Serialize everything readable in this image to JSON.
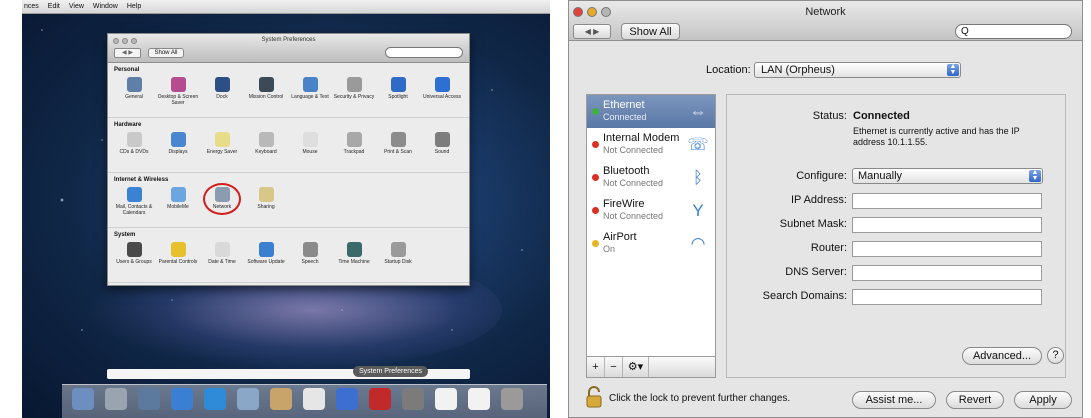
{
  "left": {
    "menubar": [
      "nces",
      "Edit",
      "View",
      "Window",
      "Help"
    ],
    "window_title": "System Preferences",
    "show_all_label": "Show All",
    "sections": [
      {
        "title": "Personal",
        "items": [
          {
            "label": "General",
            "icon": "general-icon",
            "color": "#5f7ea8"
          },
          {
            "label": "Desktop & Screen Saver",
            "icon": "desktop-icon",
            "color": "#b44c8f"
          },
          {
            "label": "Dock",
            "icon": "dock-icon",
            "color": "#2e4e86"
          },
          {
            "label": "Mission Control",
            "icon": "mission-control-icon",
            "color": "#3c4a58"
          },
          {
            "label": "Language & Text",
            "icon": "language-icon",
            "color": "#4a82c8"
          },
          {
            "label": "Security & Privacy",
            "icon": "security-icon",
            "color": "#9a9a9a"
          },
          {
            "label": "Spotlight",
            "icon": "spotlight-icon",
            "color": "#2f6bc6"
          },
          {
            "label": "Universal Access",
            "icon": "universal-access-icon",
            "color": "#2d6fd3"
          }
        ]
      },
      {
        "title": "Hardware",
        "items": [
          {
            "label": "CDs & DVDs",
            "icon": "cd-icon",
            "color": "#c9c9c9"
          },
          {
            "label": "Displays",
            "icon": "displays-icon",
            "color": "#4a86d0"
          },
          {
            "label": "Energy Saver",
            "icon": "energy-icon",
            "color": "#e7dc8a"
          },
          {
            "label": "Keyboard",
            "icon": "keyboard-icon",
            "color": "#b9b9b9"
          },
          {
            "label": "Mouse",
            "icon": "mouse-icon",
            "color": "#dedede"
          },
          {
            "label": "Trackpad",
            "icon": "trackpad-icon",
            "color": "#a8a8a8"
          },
          {
            "label": "Print & Scan",
            "icon": "printer-icon",
            "color": "#8c8c8c"
          },
          {
            "label": "Sound",
            "icon": "sound-icon",
            "color": "#7d7d7d"
          }
        ]
      },
      {
        "title": "Internet & Wireless",
        "items": [
          {
            "label": "Mail, Contacts & Calendars",
            "icon": "mail-icon",
            "color": "#3a82d2"
          },
          {
            "label": "MobileMe",
            "icon": "mobileme-icon",
            "color": "#6ba6e0"
          },
          {
            "label": "Network",
            "icon": "network-icon",
            "color": "#8b9bb0"
          },
          {
            "label": "Sharing",
            "icon": "sharing-icon",
            "color": "#d7c88a"
          }
        ]
      },
      {
        "title": "System",
        "items": [
          {
            "label": "Users & Groups",
            "icon": "users-icon",
            "color": "#4a4a4a"
          },
          {
            "label": "Parental Controls",
            "icon": "parental-controls-icon",
            "color": "#e7c12d"
          },
          {
            "label": "Date & Time",
            "icon": "date-time-icon",
            "color": "#d9d9d9"
          },
          {
            "label": "Software Update",
            "icon": "software-update-icon",
            "color": "#3a7fd0"
          },
          {
            "label": "Speech",
            "icon": "speech-icon",
            "color": "#8a8a8a"
          },
          {
            "label": "Time Machine",
            "icon": "time-machine-icon",
            "color": "#3a6a6a"
          },
          {
            "label": "Startup Disk",
            "icon": "startup-disk-icon",
            "color": "#9a9a9a"
          }
        ]
      }
    ],
    "highlighted_item": "Network",
    "highlight_color": "#d21d1d",
    "dock_tooltip": "System Preferences",
    "dock_icons": [
      "finder-icon",
      "launchpad-icon",
      "photo-browser-icon",
      "app-store-icon",
      "safari-icon",
      "mail-icon",
      "contacts-icon",
      "calendar-icon",
      "itunes-icon",
      "photo-booth-icon",
      "system-preferences-icon",
      "document-icon",
      "document-icon",
      "trash-icon"
    ]
  },
  "right": {
    "window_title": "Network",
    "nav_label": "◀ ▶",
    "show_all_label": "Show All",
    "search_glyph": "Q",
    "location_label": "Location:",
    "location_value": "LAN (Orpheus)",
    "services": [
      {
        "name": "Ethernet",
        "status": "Connected",
        "dot": "#3cb043",
        "icon": "ethernet-icon",
        "glyph": "⇔",
        "selected": true
      },
      {
        "name": "Internal Modem",
        "status": "Not Connected",
        "dot": "#d93025",
        "icon": "modem-icon",
        "glyph": "☏",
        "selected": false
      },
      {
        "name": "Bluetooth",
        "status": "Not Connected",
        "dot": "#d93025",
        "icon": "bluetooth-icon",
        "glyph": "ᛒ",
        "selected": false
      },
      {
        "name": "FireWire",
        "status": "Not Connected",
        "dot": "#d93025",
        "icon": "firewire-icon",
        "glyph": "Y",
        "selected": false
      },
      {
        "name": "AirPort",
        "status": "On",
        "dot": "#e6b422",
        "icon": "airport-icon",
        "glyph": "◠",
        "selected": false
      }
    ],
    "list_buttons": [
      "+",
      "−",
      "⚙▾"
    ],
    "status_label": "Status:",
    "status_value": "Connected",
    "status_detail": "Ethernet is currently active and has the IP address 10.1.1.55.",
    "configure_label": "Configure:",
    "configure_value": "Manually",
    "fields": [
      {
        "label": "IP Address:",
        "value": ""
      },
      {
        "label": "Subnet Mask:",
        "value": ""
      },
      {
        "label": "Router:",
        "value": ""
      },
      {
        "label": "DNS Server:",
        "value": ""
      },
      {
        "label": "Search Domains:",
        "value": ""
      }
    ],
    "advanced_label": "Advanced...",
    "help_label": "?",
    "lock_text": "Click the lock to prevent further changes.",
    "assist_label": "Assist me...",
    "revert_label": "Revert",
    "apply_label": "Apply",
    "traffic_light_colors": [
      "#e0443e",
      "#e6a92a",
      "#b5b5b5"
    ]
  }
}
